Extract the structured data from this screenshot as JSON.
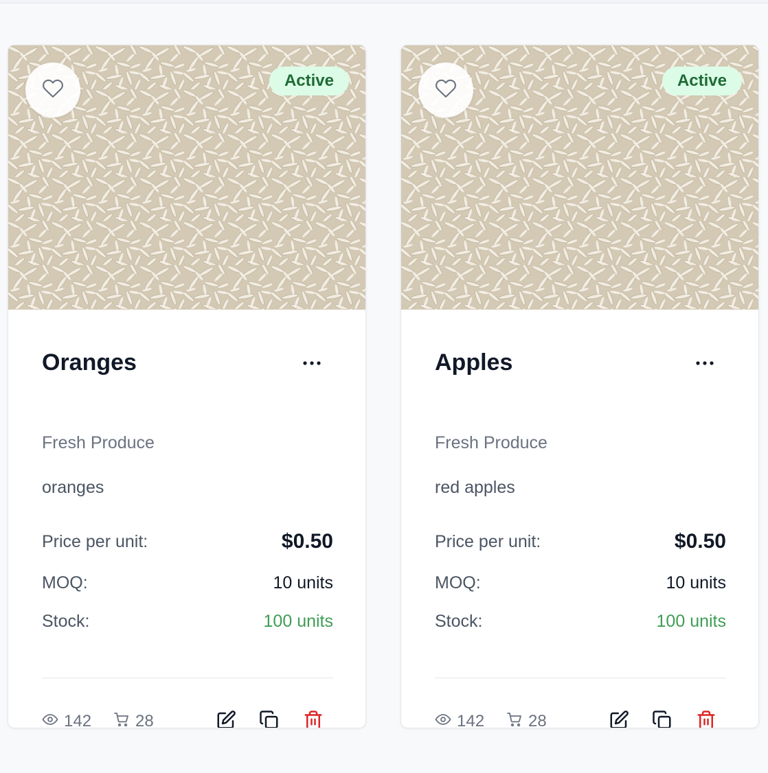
{
  "colors": {
    "active_badge_bg": "#dcfce7",
    "active_badge_text": "#1f6b35",
    "stock_text": "#3f9d55",
    "delete_icon": "#dc2626"
  },
  "products": [
    {
      "image_alt": "rice grains",
      "favorite_icon": "heart-icon",
      "status": "Active",
      "title": "Oranges",
      "more_icon": "more-horizontal-icon",
      "category": "Fresh Produce",
      "description": "oranges",
      "price_label": "Price per unit:",
      "price": "$0.50",
      "moq_label": "MOQ:",
      "moq": "10 units",
      "stock_label": "Stock:",
      "stock": "100 units",
      "views": "142",
      "cart_adds": "28",
      "actions": [
        "edit-icon",
        "copy-icon",
        "trash-icon"
      ]
    },
    {
      "image_alt": "rice grains",
      "favorite_icon": "heart-icon",
      "status": "Active",
      "title": "Apples",
      "more_icon": "more-horizontal-icon",
      "category": "Fresh Produce",
      "description": "red apples",
      "price_label": "Price per unit:",
      "price": "$0.50",
      "moq_label": "MOQ:",
      "moq": "10 units",
      "stock_label": "Stock:",
      "stock": "100 units",
      "views": "142",
      "cart_adds": "28",
      "actions": [
        "edit-icon",
        "copy-icon",
        "trash-icon"
      ]
    }
  ]
}
